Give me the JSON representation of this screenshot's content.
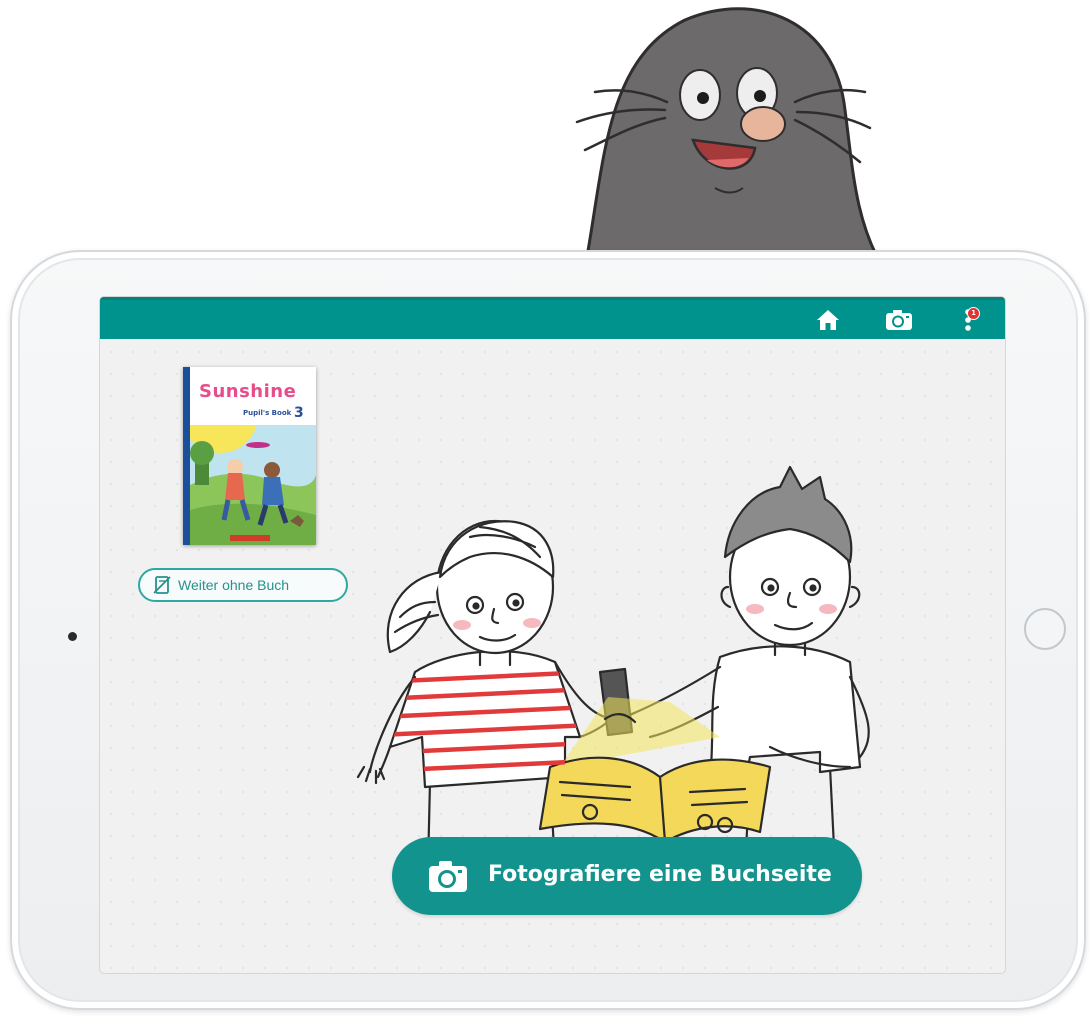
{
  "colors": {
    "teal": "#00938e",
    "button": "#13938d",
    "badge": "#e23232",
    "stripe": "#e23a3a"
  },
  "toolbar": {
    "home_icon": "home-icon",
    "camera_icon": "camera-icon",
    "menu_icon": "more-vertical-icon",
    "badge_count": "1"
  },
  "book": {
    "title": "Sunshine",
    "subtitle": "Pupil's Book",
    "volume": "3"
  },
  "no_book_button": {
    "icon": "book-crossed-icon",
    "label": "Weiter ohne Buch"
  },
  "main_button": {
    "icon": "camera-icon",
    "label": "Fotografiere eine Buchseite"
  }
}
